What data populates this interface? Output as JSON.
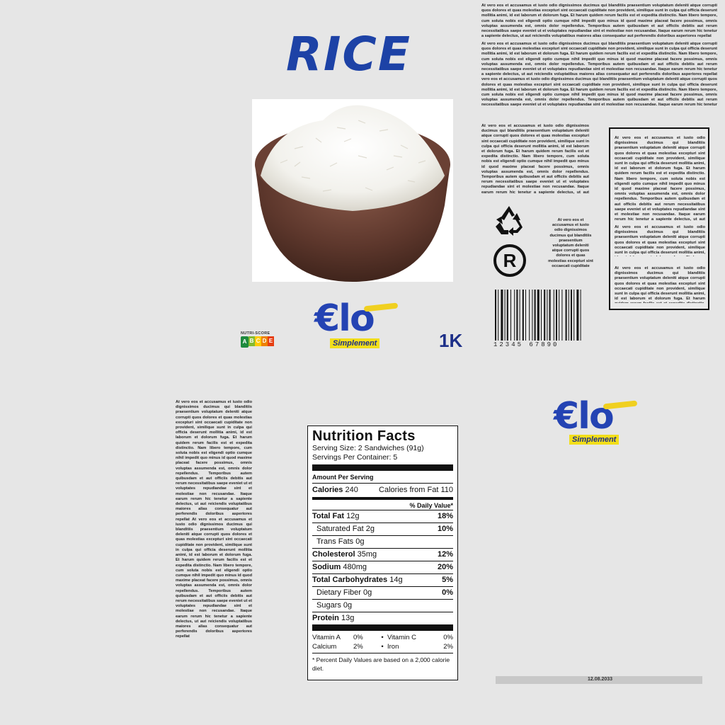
{
  "product": {
    "title": "RICE",
    "weight": "1K"
  },
  "brand": {
    "logo_text": "€lo",
    "tagline": "Simplement"
  },
  "nutri_score": {
    "label": "NUTRI-SCORE",
    "grades": [
      "A",
      "B",
      "C",
      "D",
      "E"
    ],
    "colors": [
      "#1e8a3e",
      "#85bb2f",
      "#fecb02",
      "#ee8100",
      "#e63e11"
    ],
    "highlight": "A"
  },
  "barcode": {
    "digits": "12345 67890"
  },
  "text_blocks": {
    "top_right_1": "At vero eos et accusamus et iusto odio dignissimos ducimus qui blanditiis praesentium voluptatum deleniti atque corrupti quos dolores et quas molestias excepturi sint occaecati cupiditate non provident, similique sunt in culpa qui officia deserunt mollitia animi, id est laborum et dolorum fuga. Et harum quidem rerum facilis est et expedita distinctio. Nam libero tempore, cum soluta nobis est eligendi optio cumque nihil impedit quo minus id quod maxime placeat facere possimus, omnis voluptas assumenda est, omnis dolor repellendus. Temporibus autem quibusdam et aut officiis debitis aut rerum necessitatibus saepe eveniet ut et voluptates repudiandae sint et molestiae non recusandae. Itaque earum rerum hic tenetur a sapiente delectus, ut aut reiciendis voluptatibus maiores alias consequatur aut perferendis doloribus asperiores repellat",
    "top_right_2": "At vero eos et accusamus et iusto odio dignissimos ducimus qui blanditiis praesentium voluptatum deleniti atque corrupti quos dolores et quas molestias excepturi sint occaecati cupiditate non provident, similique sunt in culpa qui officia deserunt mollitia animi, id est laborum et dolorum fuga. Et harum quidem rerum facilis est et expedita distinctio. Nam libero tempore, cum soluta nobis est eligendi optio cumque nihil impedit quo minus id quod maxime placeat facere possimus, omnis voluptas assumenda est, omnis dolor repellendus. Temporibus autem quibusdam et aut officiis debitis aut rerum necessitatibus saepe eveniet ut et voluptates repudiandae sint et molestiae non recusandae. Itaque earum rerum hic tenetur a sapiente delectus, ut aut reiciendis voluptatibus maiores alias consequatur aut perferendis doloribus asperiores repellat vero eos et accusamus et iusto odio dignissimos ducimus qui blanditiis praesentium voluptatum deleniti atque corrupti quos dolores et quas molestias excepturi sint occaecati cupiditate non provident, similique sunt in culpa qui officia deserunt mollitia animi, id est laborum et dolorum fuga. Et harum quidem rerum facilis est et expedita distinctio. Nam libero tempore, cum soluta nobis est eligendi optio cumque nihil impedit quo minus id quod maxime placeat facere possimus, omnis voluptas assumenda est, omnis dolor repellendus. Temporibus autem quibusdam et aut officiis debitis aut rerum necessitatibus saepe eveniet ut et voluptates repudiandae sint et molestiae non recusandae. Itaque earum rerum hic tenetur a sapiente delectus, ut aut reiciendis voluptatibus maiores alias consequatur aut perferendis doloribus asperiores repellat",
    "mid_right": "At vero eos et accusamus et iusto odio dignissimos ducimus qui blanditiis praesentium voluptatum deleniti atque corrupti quos dolores et quas molestias excepturi sint occaecati cupiditate non provident, similique sunt in culpa qui officia deserunt mollitia animi, id est laborum et dolorum fuga. Et harum quidem rerum facilis est et expedita distinctio. Nam libero tempore, cum soluta nobis est eligendi optio cumque nihil impedit quo minus id quod maxime placeat facere possimus, omnis voluptas assumenda est, omnis dolor repellendus. Temporibus autem quibusdam et aut officiis debitis aut rerum necessitatibus saepe eveniet ut et voluptates repudiandae sint et molestiae non recusandae. Itaque earum rerum hic tenetur a sapiente delectus, ut aut reiciendis voluptatibus maiores alias consequatur aut perferendis doloribus asperiores repellat",
    "small_column": "At vero eos et accusamus et iusto odio dignissimos ducimus qui blanditiis praesentium voluptatum deleniti atque corrupti quos dolores et quas molestias excepturi sint occaecati cupiditate non provident, similique sunt in",
    "frame_1": "At vero eos et accusamus et iusto odio dignissimos ducimus qui blanditiis praesentium voluptatum deleniti atque corrupti quos dolores et quas molestias excepturi sint occaecati cupiditate non provident, similique sunt in culpa qui officia deserunt mollitia animi, id est laborum et dolorum fuga. Et harum quidem rerum facilis est et expedita distinctio. Nam libero tempore, cum soluta nobis est eligendi optio cumque nihil impedit quo minus id quod maxime placeat facere possimus, omnis voluptas assumenda est, omnis dolor repellendus. Temporibus autem quibusdam et aut officiis debitis aut rerum necessitatibus saepe eveniet ut et voluptates repudiandae sint et molestiae non recusandae. Itaque earum rerum hic tenetur a sapiente delectus, ut aut reiciendis voluptatibus maiores alias consequatur aut perferendis doloribus asperiores repellat",
    "frame_2": "At vero eos et accusamus et iusto odio dignissimos ducimus qui blanditiis praesentium voluptatum deleniti atque corrupti quos dolores et quas molestias excepturi sint occaecati cupiditate non provident, similique sunt in culpa qui officia deserunt mollitia animi, id est laborum et dolorum fuga. Et harum quidem rerum facilis est et expedita distinctio. Nam libero",
    "frame_3": "At vero eos et accusamus et iusto odio dignissimos ducimus qui blanditiis praesentium voluptatum deleniti atque corrupti quos dolores et quas molestias excepturi sint occaecati cupiditate non provident, similique sunt in culpa qui officia deserunt mollitia animi, id est laborum et dolorum fuga. Et harum quidem rerum facilis est et expedita distinctio. Nam libero",
    "left_column": "At vero eos et accusamus et iusto odio dignissimos ducimus qui blanditiis praesentium voluptatum deleniti atque corrupti quos dolores et quas molestias excepturi sint occaecati cupiditate non provident, similique sunt in culpa qui officia deserunt mollitia animi, id est laborum et dolorum fuga. Et harum quidem rerum facilis est et expedita distinctio. Nam libero tempore, cum soluta nobis est eligendi optio cumque nihil impedit quo minus id quod maxime placeat facere possimus, omnis voluptas assumenda est, omnis dolor repellendus. Temporibus autem quibusdam et aut officiis debitis aut rerum necessitatibus saepe eveniet ut et voluptates repudiandae sint et molestiae non recusandae. Itaque earum rerum hic tenetur a sapiente delectus, ut aut reiciendis voluptatibus maiores alias consequatur aut perferendis doloribus asperiores repellat At vero eos et accusamus et iusto odio dignissimos ducimus qui blanditiis praesentium voluptatum deleniti atque corrupti quos dolores et quas molestias excepturi sint occaecati cupiditate non provident, similique sunt in culpa qui officia deserunt mollitia animi, id est laborum et dolorum fuga. Et harum quidem rerum facilis est et expedita distinctio. Nam libero tempore, cum soluta nobis est eligendi optio cumque nihil impedit quo minus id quod maxime placeat facere possimus, omnis voluptas assumenda est, omnis dolor repellendus. Temporibus autem quibusdam et aut officiis debitis aut rerum necessitatibus saepe eveniet ut et voluptates repudiandae sint et molestiae non recusandae. Itaque earum rerum hic tenetur a sapiente delectus, ut aut reiciendis voluptatibus maiores alias consequatur aut perferendis doloribus asperiores repellat"
  },
  "nutrition": {
    "title": "Nutrition Facts",
    "serving_size": "Serving Size: 2 Sandwiches (91g)",
    "servings_per_container": "Servings Per Container: 5",
    "amount_per_serving": "Amount Per Serving",
    "calories_label": "Calories",
    "calories_value": "240",
    "calories_fat": "Calories from Fat 110",
    "daily_value_header": "% Daily Value*",
    "rows": [
      {
        "label": "Total Fat",
        "amount": "12g",
        "dv": "18%",
        "bold": true,
        "indent": false
      },
      {
        "label": "Saturated Fat",
        "amount": "2g",
        "dv": "10%",
        "bold": false,
        "indent": true
      },
      {
        "label": "Trans Fats",
        "amount": "0g",
        "dv": "",
        "bold": false,
        "indent": true
      },
      {
        "label": "Cholesterol",
        "amount": "35mg",
        "dv": "12%",
        "bold": true,
        "indent": false
      },
      {
        "label": "Sodium",
        "amount": "480mg",
        "dv": "20%",
        "bold": true,
        "indent": false
      },
      {
        "label": "Total Carbohydrates",
        "amount": "14g",
        "dv": "5%",
        "bold": true,
        "indent": false
      },
      {
        "label": "Dietary Fiber",
        "amount": "0g",
        "dv": "0%",
        "bold": false,
        "indent": true
      },
      {
        "label": "Sugars",
        "amount": "0g",
        "dv": "",
        "bold": false,
        "indent": true
      },
      {
        "label": "Protein",
        "amount": "13g",
        "dv": "",
        "bold": true,
        "indent": false
      }
    ],
    "vitamins": [
      {
        "left_label": "Vitamin A",
        "left_value": "0%",
        "right_label": "Vitamin C",
        "right_value": "0%"
      },
      {
        "left_label": "Calcium",
        "left_value": "2%",
        "right_label": "Iron",
        "right_value": "2%"
      }
    ],
    "footnote": "* Percent Daily Values are based on a 2,000 calorie diet."
  },
  "date": "12.08.2033",
  "icons": {
    "recycle": "recycle-icon",
    "registered": "registered-icon"
  }
}
